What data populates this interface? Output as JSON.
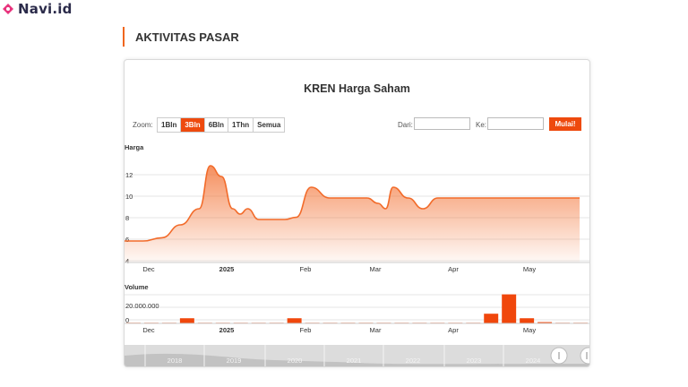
{
  "brand": {
    "name": "Navi.id",
    "accent": "#e8327c"
  },
  "section": {
    "title": "AKTIVITAS PASAR"
  },
  "chart_card": {
    "title": "KREN Harga Saham",
    "zoom": {
      "label": "Zoom:",
      "options": [
        "1Bln",
        "3Bln",
        "6Bln",
        "1Thn",
        "Semua"
      ],
      "selected": "3Bln"
    },
    "range": {
      "from_label": "Dari:",
      "from_value": "",
      "to_label": "Ke:",
      "to_value": "",
      "go_label": "Mulai!"
    }
  },
  "chart_data": [
    {
      "type": "area",
      "ylabel": "Harga",
      "ylim": [
        4,
        14
      ],
      "yticks": [
        "4",
        "6",
        "8",
        "10",
        "12"
      ],
      "xticks": [
        "Dec",
        "2025",
        "Feb",
        "Mar",
        "Apr",
        "May"
      ],
      "color": "#f26b2a",
      "x": [
        0,
        0.5,
        1.0,
        1.5,
        2.0,
        2.3,
        2.6,
        2.9,
        3.1,
        3.3,
        3.6,
        3.9,
        4.3,
        4.6,
        5.0,
        5.5,
        6.0,
        6.5,
        6.8,
        7.0,
        7.2,
        7.6,
        8.0,
        8.4,
        8.8,
        9.2,
        9.5,
        9.8,
        10.1,
        10.5,
        11.0,
        11.5,
        11.8,
        12.2
      ],
      "values": [
        6,
        6,
        6.3,
        7.5,
        9,
        13,
        12,
        9,
        8.5,
        9,
        8,
        8,
        8,
        8.2,
        11,
        10,
        10,
        10,
        9.5,
        9,
        11,
        10,
        9,
        10,
        10,
        10,
        10,
        10,
        10,
        10,
        10,
        10,
        10,
        10
      ]
    },
    {
      "type": "bar",
      "ylabel": "Volume",
      "yticks": [
        "0",
        "20.000.000"
      ],
      "xticks": [
        "Dec",
        "2025",
        "Feb",
        "Mar",
        "Apr",
        "May"
      ],
      "color": "#f0470c",
      "values": [
        0,
        0,
        0,
        8000000,
        0,
        0,
        0,
        0,
        0,
        8000000,
        0,
        0,
        0,
        0,
        0,
        0,
        0,
        0,
        0,
        0,
        15000000,
        45000000,
        8000000,
        2000000,
        0,
        0
      ]
    }
  ],
  "navigator": {
    "years": [
      "2018",
      "2019",
      "2020",
      "2021",
      "2022",
      "2023",
      "2024"
    ]
  }
}
